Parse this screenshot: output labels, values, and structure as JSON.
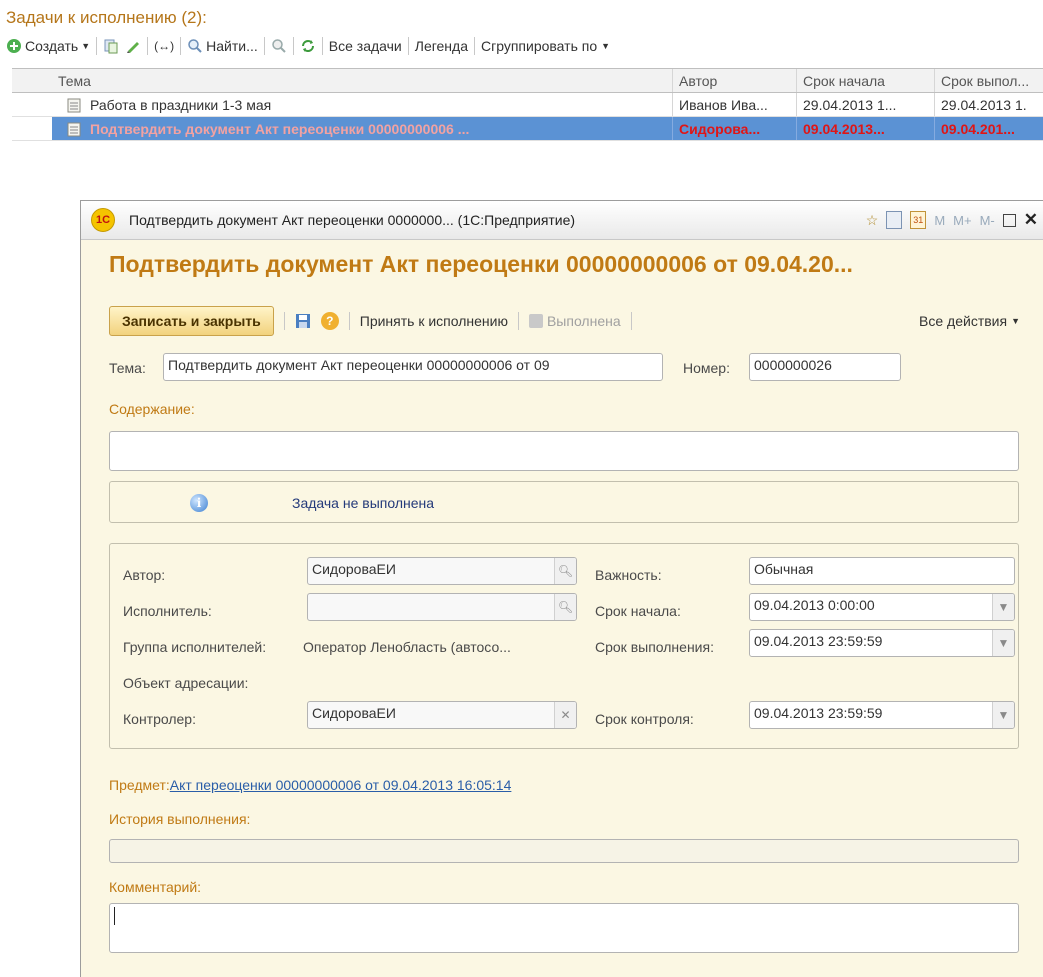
{
  "list": {
    "title": "Задачи к исполнению (2):",
    "toolbar": {
      "create": "Создать",
      "find": "Найти...",
      "all_tasks": "Все задачи",
      "legend": "Легенда",
      "group_by": "Сгруппировать по"
    },
    "columns": [
      "Тема",
      "Автор",
      "Срок начала",
      "Срок выпол..."
    ],
    "rows": [
      {
        "subject": "Работа в праздники 1-3 мая",
        "author": "Иванов Ива...",
        "start": "29.04.2013 1...",
        "due": "29.04.2013 1."
      },
      {
        "subject": "Подтвердить документ Акт переоценки 00000000006 ...",
        "author": "Сидорова...",
        "start": "09.04.2013...",
        "due": "09.04.201..."
      }
    ]
  },
  "window": {
    "logo": "1С",
    "title": "Подтвердить документ Акт переоценки 0000000... (1С:Предприятие)",
    "m_buttons": [
      "M",
      "M+",
      "M-"
    ]
  },
  "form": {
    "heading": "Подтвердить документ Акт переоценки 00000000006 от 09.04.20...",
    "toolbar": {
      "save_close": "Записать и закрыть",
      "accept": "Принять к исполнению",
      "done": "Выполнена",
      "all_actions": "Все действия"
    },
    "subject_label": "Тема:",
    "subject_value": "Подтвердить документ Акт переоценки 00000000006 от 09",
    "number_label": "Номер:",
    "number_value": "0000000026",
    "content_label": "Содержание:",
    "content_value": "",
    "status_text": "Задача не выполнена",
    "author_label": "Автор:",
    "author_value": "СидороваЕИ",
    "executor_label": "Исполнитель:",
    "executor_value": "",
    "group_label": "Группа исполнителей:",
    "group_value": "Оператор Ленобласть (автосо...",
    "address_label": "Объект адресации:",
    "controller_label": "Контролер:",
    "controller_value": "СидороваЕИ",
    "importance_label": "Важность:",
    "importance_value": "Обычная",
    "start_label": "Срок начала:",
    "start_value": "09.04.2013  0:00:00",
    "due_label": "Срок выполнения:",
    "due_value": "09.04.2013 23:59:59",
    "control_label": "Срок контроля:",
    "control_value": "09.04.2013 23:59:59",
    "subject_ref_label": "Предмет:",
    "subject_ref_link": "Акт переоценки 00000000006 от 09.04.2013 16:05:14",
    "history_label": "История выполнения:",
    "comment_label": "Комментарий:",
    "comment_value": ""
  },
  "colors": {
    "accent_orange": "#c07a14",
    "selection_blue": "#5b92d4",
    "overdue_red": "#e01515",
    "form_bg": "#fbf7e3"
  }
}
